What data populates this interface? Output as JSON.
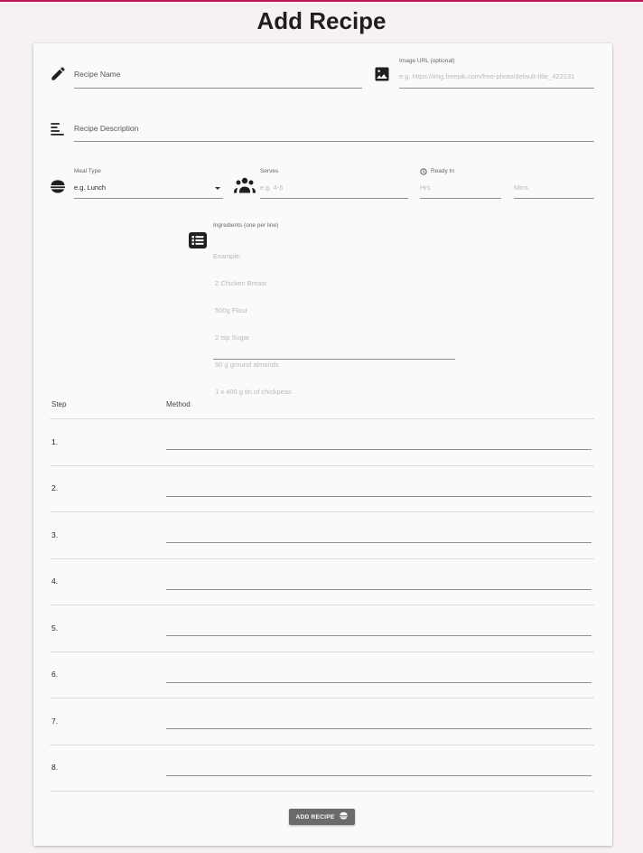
{
  "page": {
    "title": "Add Recipe"
  },
  "form": {
    "recipe_name": {
      "label": "Recipe Name",
      "icon": "pencil-icon"
    },
    "image_url": {
      "label": "Image URL (optional)",
      "placeholder": "e.g. https://img.freepik.com/free-photo/default-title_422131",
      "icon": "image-icon"
    },
    "description": {
      "label": "Recipe Description",
      "icon": "description-icon"
    },
    "meal_type": {
      "label": "Meal Type",
      "value": "e.g. Lunch",
      "icon": "bowl-icon"
    },
    "serves": {
      "label": "Serves",
      "placeholder": "e.g. 4-6",
      "icon": "people-icon"
    },
    "ready_in": {
      "label": "Ready In",
      "hrs_placeholder": "Hrs",
      "mins_placeholder": "Mins",
      "icon": "clock-icon"
    },
    "ingredients": {
      "label": "Ingredients (one per line)",
      "icon": "list-icon",
      "placeholder_lines": [
        "Example:",
        " 2 Chicken Breast",
        " 500g Flour",
        " 2 tsp Sugar",
        " 50 g ground almonds",
        " 1 x 400 g tin of chickpeas"
      ]
    }
  },
  "steps_table": {
    "headers": {
      "step": "Step",
      "method": "Method"
    },
    "steps": [
      "1.",
      "2.",
      "3.",
      "4.",
      "5.",
      "6.",
      "7.",
      "8."
    ]
  },
  "actions": {
    "add_recipe_label": "ADD RECIPE",
    "add_recipe_icon": "bowl-icon"
  }
}
